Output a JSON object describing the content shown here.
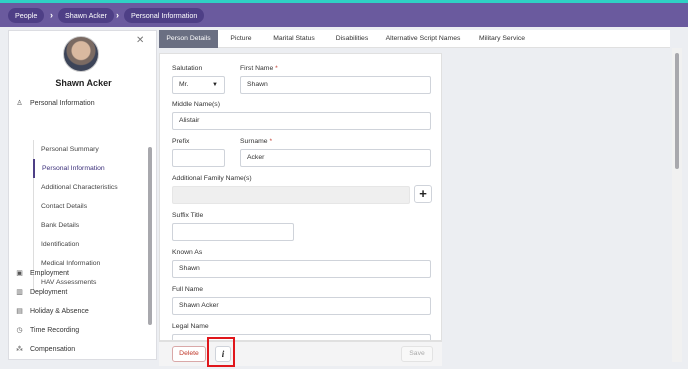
{
  "breadcrumb": [
    "People",
    "Shawn Acker",
    "Personal Information"
  ],
  "profile": {
    "name": "Shawn Acker"
  },
  "sidebar": {
    "sections": [
      {
        "label": "Personal Information",
        "icon": "person-icon"
      },
      {
        "label": "Employment",
        "icon": "briefcase-icon"
      },
      {
        "label": "Deployment",
        "icon": "building-icon"
      },
      {
        "label": "Holiday & Absence",
        "icon": "calendar-icon"
      },
      {
        "label": "Time Recording",
        "icon": "clock-icon"
      },
      {
        "label": "Compensation",
        "icon": "coins-icon"
      }
    ],
    "sub_items": [
      "Personal Summary",
      "Personal Information",
      "Additional Characteristics",
      "Contact Details",
      "Bank Details",
      "Identification",
      "Medical Information",
      "HAV Assessments"
    ],
    "active_sub": "Personal Information"
  },
  "tabs": [
    "Person Details",
    "Picture",
    "Marital Status",
    "Disabilities",
    "Alternative Script Names",
    "Military Service"
  ],
  "active_tab": "Person Details",
  "form": {
    "salutation_label": "Salutation",
    "salutation_value": "Mr.",
    "first_name_label": "First Name",
    "first_name_value": "Shawn",
    "middle_label": "Middle Name(s)",
    "middle_value": "Alistair",
    "prefix_label": "Prefix",
    "prefix_value": "",
    "surname_label": "Surname",
    "surname_value": "Acker",
    "family_label": "Additional Family Name(s)",
    "family_value": "",
    "suffix_label": "Suffix Title",
    "suffix_value": "",
    "known_label": "Known As",
    "known_value": "Shawn",
    "full_label": "Full Name",
    "full_value": "Shawn Acker",
    "legal_label": "Legal Name",
    "required_mark": "*"
  },
  "footer": {
    "delete": "Delete",
    "info": "i",
    "save": "Save"
  },
  "colors": {
    "header": "#6a5a9e",
    "header_accent": "#2fd1c4",
    "active_tab": "#6a6f82",
    "delete": "#c0392b",
    "highlight": "#e0161b"
  }
}
